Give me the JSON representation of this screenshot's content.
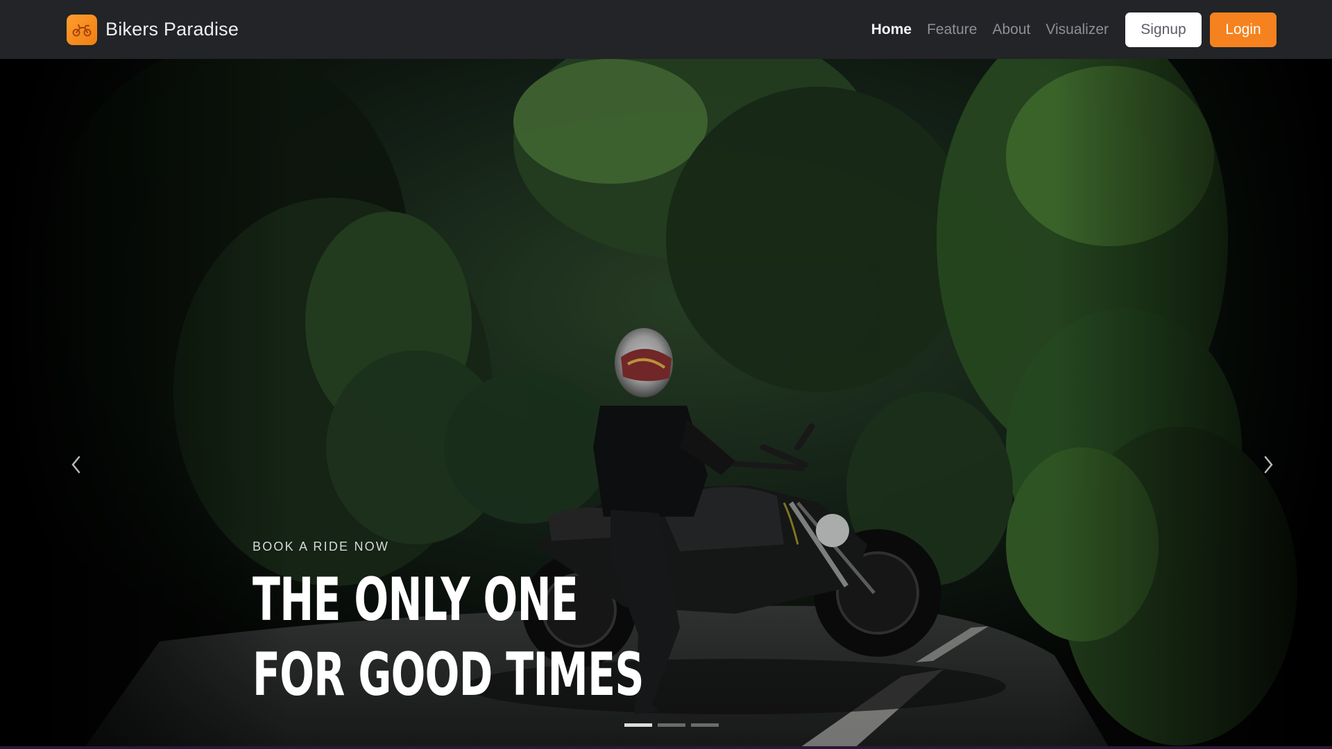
{
  "brand": {
    "name": "Bikers Paradise",
    "logo_icon": "motorbike-icon",
    "logo_color": "#f5821f"
  },
  "nav": {
    "links": [
      {
        "label": "Home",
        "active": true
      },
      {
        "label": "Feature",
        "active": false
      },
      {
        "label": "About",
        "active": false
      },
      {
        "label": "Visualizer",
        "active": false
      }
    ],
    "signup_label": "Signup",
    "login_label": "Login"
  },
  "hero": {
    "eyebrow": "BOOK A RIDE NOW",
    "headline_line1": "THE ONLY ONE",
    "headline_line2": "FOR GOOD TIMES",
    "prev_icon": "chevron-left-icon",
    "next_icon": "chevron-right-icon",
    "slides_count": 3,
    "active_slide": 1
  },
  "colors": {
    "accent": "#f5821f",
    "navbar_bg": "#222427"
  }
}
